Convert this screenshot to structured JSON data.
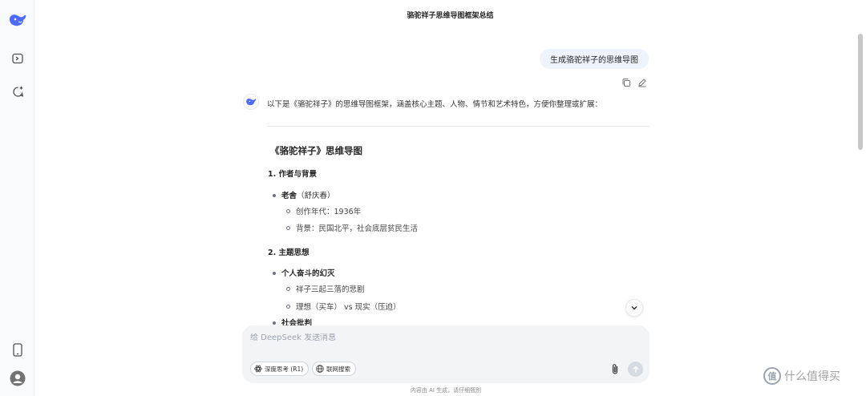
{
  "header": {
    "title": "骆驼祥子思维导图框架总结"
  },
  "user_message": {
    "text": "生成骆驼祥子的思维导图"
  },
  "assistant": {
    "intro": "以下是《骆驼祥子》的思维导图框架，涵盖核心主题、人物、情节和艺术特色，方便你整理或扩展：",
    "title": "《骆驼祥子》思维导图",
    "sections": [
      {
        "heading": "1. 作者与背景",
        "items": [
          {
            "bold": "老舍",
            "rest": "（舒庆春）",
            "sub": [
              "创作年代：1936年",
              "背景：民国北平，社会底层贫民生活"
            ]
          }
        ]
      },
      {
        "heading": "2. 主题思想",
        "items": [
          {
            "bold": "个人奋斗的幻灭",
            "rest": "",
            "sub": [
              "祥子三起三落的悲剧",
              "理想（买车） vs 现实（压迫）"
            ]
          },
          {
            "bold": "社会批判",
            "rest": "",
            "sub": []
          }
        ]
      }
    ]
  },
  "composer": {
    "placeholder": "给 DeepSeek 发送消息",
    "deep_think_label": "深度思考 (R1)",
    "search_label": "联网搜索"
  },
  "footer": {
    "disclaimer": "内容由 AI 生成，请仔细甄别"
  },
  "watermark": {
    "badge": "值",
    "text": "什么值得买"
  },
  "colors": {
    "accent": "#4d6bfe",
    "bubble": "#eef3fc",
    "composer": "#f3f4f6"
  },
  "icons": [
    "deepseek-logo-icon",
    "toggle-sidebar-icon",
    "new-chat-icon",
    "phone-icon",
    "user-avatar-icon",
    "copy-icon",
    "edit-icon",
    "chevron-down-icon",
    "atom-icon",
    "globe-icon",
    "paperclip-icon",
    "arrow-up-icon"
  ]
}
